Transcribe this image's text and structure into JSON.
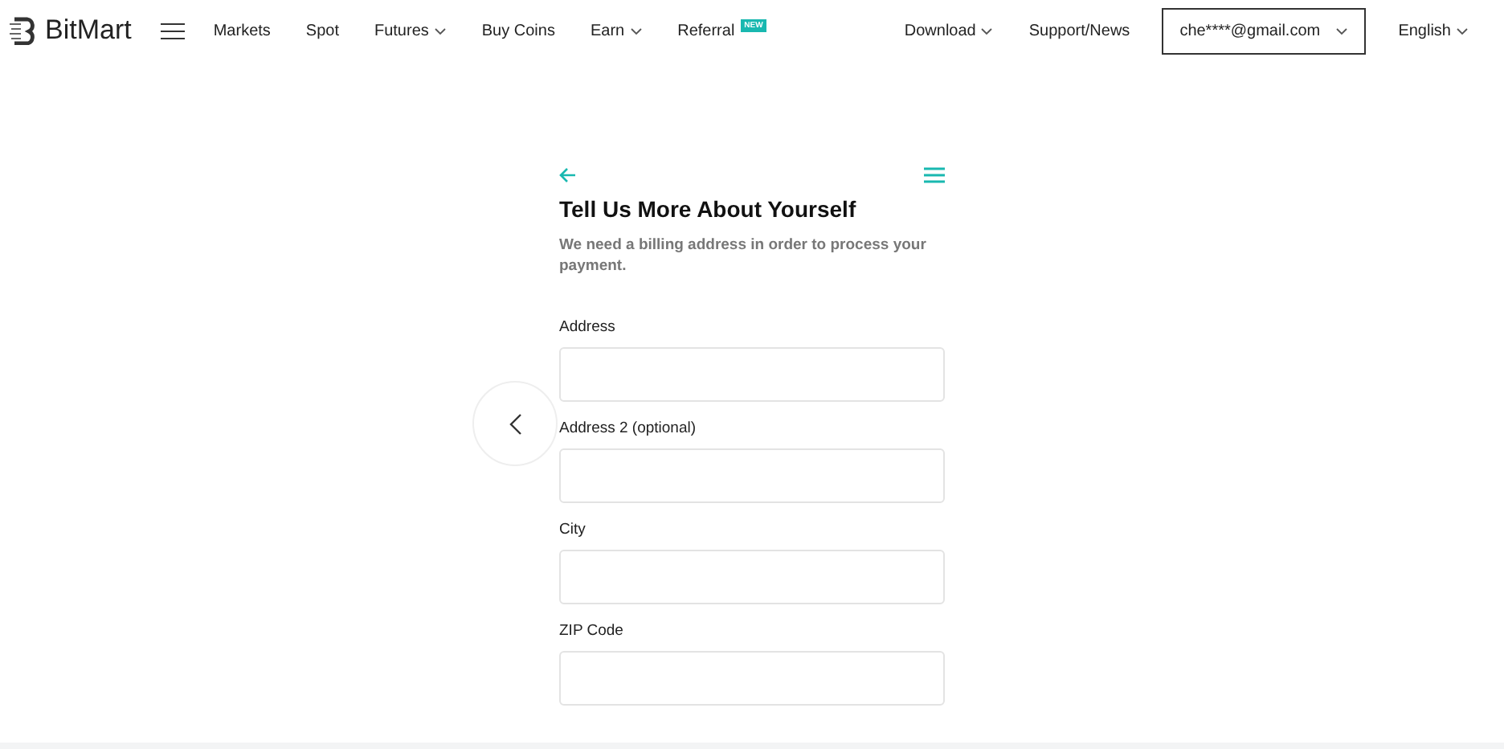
{
  "header": {
    "logo": "BitMart",
    "nav": [
      {
        "label": "Markets",
        "dropdown": false
      },
      {
        "label": "Spot",
        "dropdown": false
      },
      {
        "label": "Futures",
        "dropdown": true
      },
      {
        "label": "Buy Coins",
        "dropdown": false
      },
      {
        "label": "Earn",
        "dropdown": true
      },
      {
        "label": "Referral",
        "dropdown": false,
        "badge": "NEW"
      }
    ],
    "right": [
      {
        "label": "Download",
        "dropdown": true
      },
      {
        "label": "Support/News",
        "dropdown": false
      }
    ],
    "account": "che****@gmail.com",
    "language": "English"
  },
  "form": {
    "title": "Tell Us More About Yourself",
    "subtitle": "We need a billing address in order to process your payment.",
    "fields": [
      {
        "label": "Address"
      },
      {
        "label": "Address 2 (optional)"
      },
      {
        "label": "City"
      },
      {
        "label": "ZIP Code"
      }
    ]
  }
}
